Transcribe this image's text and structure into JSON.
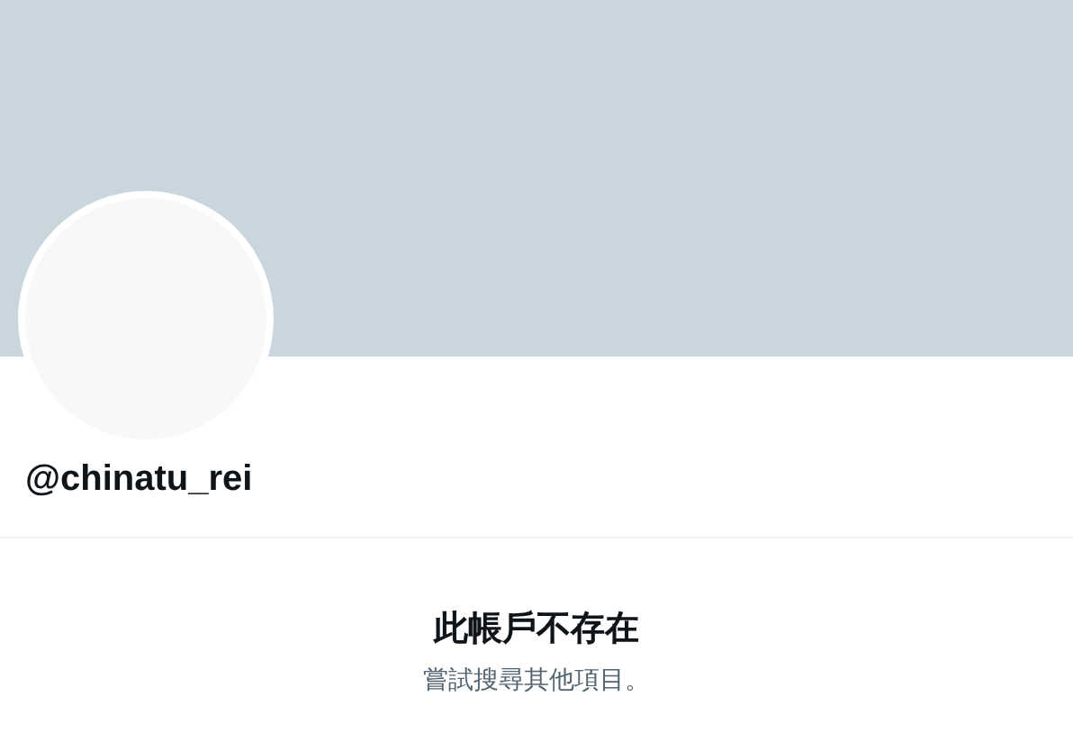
{
  "profile": {
    "handle": "@chinatu_rei"
  },
  "empty_state": {
    "title": "此帳戶不存在",
    "subtitle": "嘗試搜尋其他項目。"
  }
}
